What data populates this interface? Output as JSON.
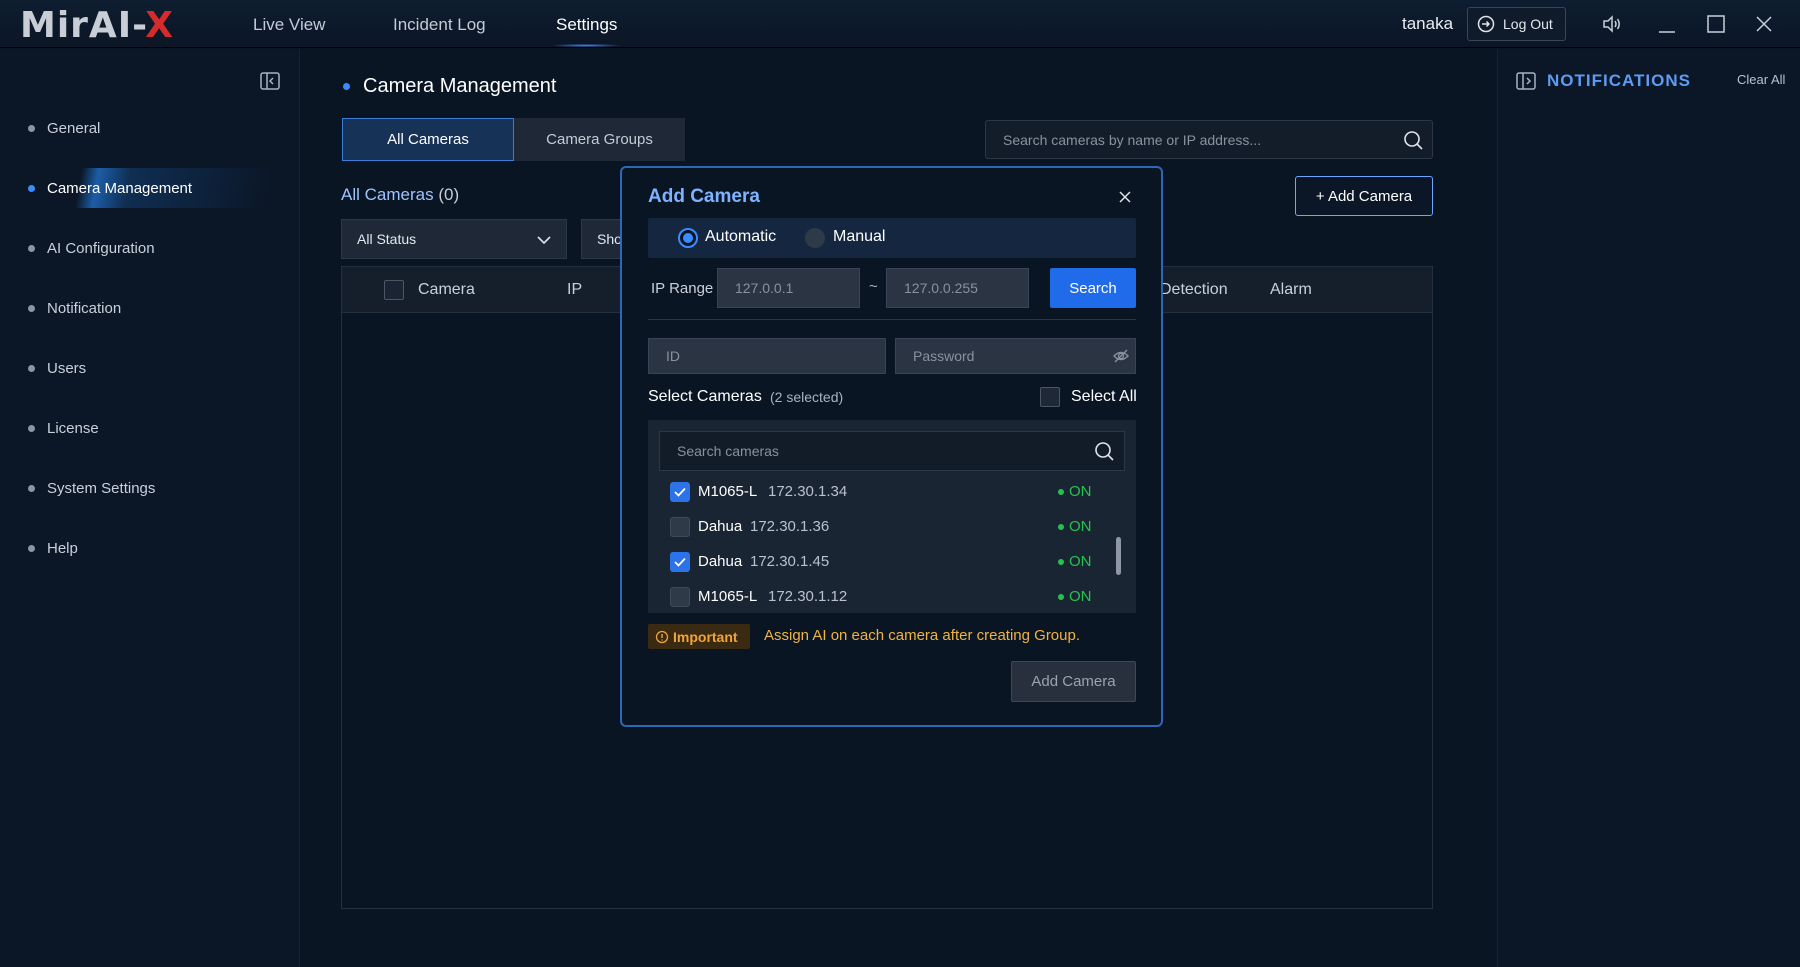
{
  "app": {
    "logo_main": "MirAI-",
    "logo_x": "X",
    "user": "tanaka",
    "logout_label": "Log Out"
  },
  "topnav": [
    "Live View",
    "Incident Log",
    "Settings"
  ],
  "sidebar": {
    "items": [
      {
        "label": "General"
      },
      {
        "label": "Camera Management"
      },
      {
        "label": "AI Configuration"
      },
      {
        "label": "Notification"
      },
      {
        "label": "Users"
      },
      {
        "label": "License"
      },
      {
        "label": "System Settings"
      },
      {
        "label": "Help"
      }
    ]
  },
  "main": {
    "title": "Camera Management",
    "tabs": [
      "All Cameras",
      "Camera Groups"
    ],
    "search_placeholder": "Search cameras by name or IP address...",
    "list_title": "All Cameras",
    "list_count": "(0)",
    "add_camera_label": "+ Add Camera",
    "status_filter": "All Status",
    "second_filter": "Sho",
    "columns": [
      "Camera",
      "IP",
      "Detection",
      "Alarm"
    ]
  },
  "notifications": {
    "title": "NOTIFICATIONS",
    "clear_label": "Clear All"
  },
  "modal": {
    "title": "Add Camera",
    "modes": [
      "Automatic",
      "Manual"
    ],
    "selected_mode": "Automatic",
    "ip_range_label": "IP Range",
    "ip_start": "127.0.0.1",
    "ip_end": "127.0.0.255",
    "ip_separator": "~",
    "search_label": "Search",
    "id_placeholder": "ID",
    "password_placeholder": "Password",
    "select_title": "Select Cameras",
    "selected_count": "(2 selected)",
    "select_all_label": "Select All",
    "camera_search_placeholder": "Search cameras",
    "cameras": [
      {
        "name": "M1065-L",
        "ip": "172.30.1.34",
        "status": "ON",
        "checked": true
      },
      {
        "name": "Dahua",
        "ip": "172.30.1.36",
        "status": "ON",
        "checked": false
      },
      {
        "name": "Dahua",
        "ip": "172.30.1.45",
        "status": "ON",
        "checked": true
      },
      {
        "name": "M1065-L",
        "ip": "172.30.1.12",
        "status": "ON",
        "checked": false
      }
    ],
    "important_label": "Important",
    "important_message": "Assign AI on each camera after creating Group.",
    "submit_label": "Add Camera"
  },
  "colors": {
    "accent": "#1f6bea",
    "status_on": "#27c24c",
    "warning": "#f2a43a",
    "logo_x": "#d62b2b"
  }
}
